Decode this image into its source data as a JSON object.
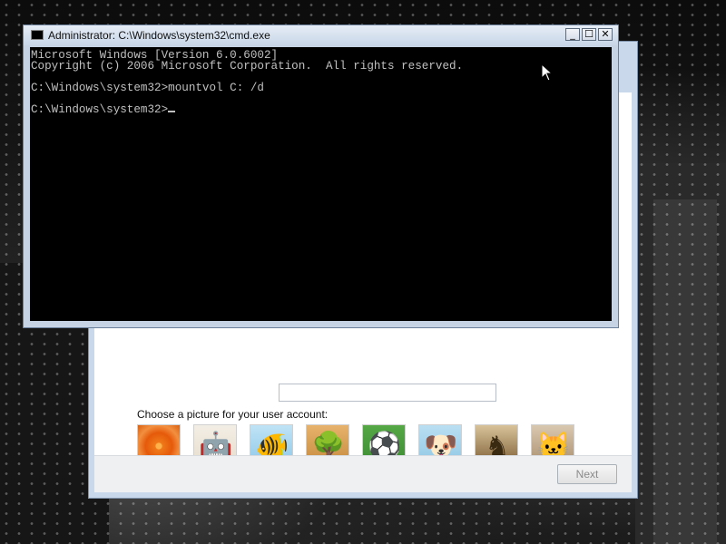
{
  "cmd_window": {
    "title": "Administrator: C:\\Windows\\system32\\cmd.exe",
    "controls": {
      "minimize": "_",
      "maximize": "☐",
      "close": "✕"
    },
    "lines": [
      "Microsoft Windows [Version 6.0.6002]",
      "Copyright (c) 2006 Microsoft Corporation.  All rights reserved.",
      "",
      "C:\\Windows\\system32>mountvol C: /d",
      "",
      "C:\\Windows\\system32>"
    ]
  },
  "setup": {
    "choose_label": "Choose a picture for your user account:",
    "pictures": [
      "flower",
      "robot",
      "goldfish",
      "bonsai",
      "sports-balls",
      "puppy",
      "chess",
      "kitten"
    ],
    "next_label": "Next",
    "next_enabled": false
  },
  "colors": {
    "console_bg": "#000000",
    "console_text": "#c0c0c0",
    "titlebar": "#c8d6e8"
  }
}
